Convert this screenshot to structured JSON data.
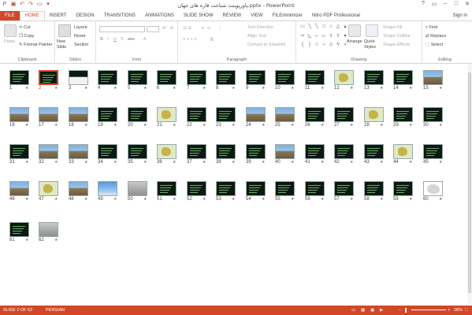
{
  "window": {
    "title": "پاورپوینت شناخت قاره های جهان.pptx - PowerPoint",
    "sign_in": "Sign in"
  },
  "tabs": [
    "FILE",
    "HOME",
    "INSERT",
    "DESIGN",
    "TRANSITIONS",
    "ANIMATIONS",
    "SLIDE SHOW",
    "REVIEW",
    "VIEW",
    "FILEminimizer",
    "Nitro PDF Professional"
  ],
  "ribbon": {
    "clipboard": {
      "label": "Clipboard",
      "paste": "Paste",
      "cut": "Cut",
      "copy": "Copy",
      "format_painter": "Format Painter"
    },
    "slides": {
      "label": "Slides",
      "new_slide": "New Slide",
      "layout": "Layout",
      "reset": "Reset",
      "section": "Section"
    },
    "font": {
      "label": "Font",
      "bold": "B",
      "italic": "I",
      "underline": "U",
      "strike": "S",
      "abc": "abc"
    },
    "paragraph": {
      "label": "Paragraph",
      "text_direction": "Text Direction",
      "align_text": "Align Text",
      "convert": "Convert to SmartArt"
    },
    "drawing": {
      "label": "Drawing",
      "arrange": "Arrange",
      "quick_styles": "Quick Styles",
      "shape_fill": "Shape Fill",
      "shape_outline": "Shape Outline",
      "shape_effects": "Shape Effects"
    },
    "editing": {
      "label": "Editing",
      "find": "Find",
      "replace": "Replace",
      "select": "Select"
    }
  },
  "slides": {
    "star_glyph": "★",
    "types": [
      "dark",
      "dark",
      "split",
      "dark",
      "dark",
      "dark",
      "dark",
      "dark",
      "dark",
      "dark",
      "dark",
      "map",
      "dark",
      "dark",
      "photo",
      "photo",
      "photo",
      "photo",
      "dark",
      "dark",
      "map",
      "dark",
      "dark",
      "photo",
      "photo",
      "dark",
      "dark",
      "map",
      "dark",
      "dark",
      "dark",
      "photo",
      "photo",
      "dark",
      "dark",
      "map",
      "dark",
      "dark",
      "dark",
      "photo",
      "dark",
      "dark",
      "dark",
      "map",
      "dark",
      "photo",
      "map",
      "photo",
      "sea",
      "grey",
      "dark",
      "dark",
      "dark",
      "dark",
      "dark",
      "dark",
      "dark",
      "dark",
      "dark",
      "white",
      "dark",
      "grey"
    ],
    "selected": 2,
    "total": 62
  },
  "status": {
    "slide_info": "SLIDE 2 OF 62",
    "language": "PERSIAN",
    "zoom": "28%"
  }
}
